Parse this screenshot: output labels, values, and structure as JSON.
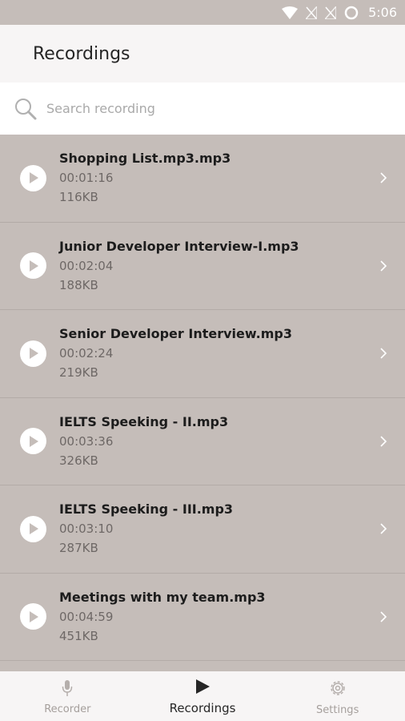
{
  "status_bar": {
    "time": "5:06",
    "icons": [
      "wifi-icon",
      "signal-off-icon",
      "signal-off-icon",
      "circle-icon"
    ]
  },
  "header": {
    "title": "Recordings"
  },
  "search": {
    "placeholder": "Search recording",
    "value": ""
  },
  "recordings": [
    {
      "name": "Shopping List.mp3.mp3",
      "duration": "00:01:16",
      "size": "116KB"
    },
    {
      "name": "Junior Developer Interview-I.mp3",
      "duration": "00:02:04",
      "size": "188KB"
    },
    {
      "name": "Senior Developer Interview.mp3",
      "duration": "00:02:24",
      "size": "219KB"
    },
    {
      "name": "IELTS Speeking - II.mp3",
      "duration": "00:03:36",
      "size": "326KB"
    },
    {
      "name": "IELTS Speeking - III.mp3",
      "duration": "00:03:10",
      "size": "287KB"
    },
    {
      "name": "Meetings with my team.mp3",
      "duration": "00:04:59",
      "size": "451KB"
    }
  ],
  "bottom_nav": {
    "tabs": [
      {
        "label": "Recorder",
        "icon": "microphone-icon",
        "active": false
      },
      {
        "label": "Recordings",
        "icon": "play-icon",
        "active": true
      },
      {
        "label": "Settings",
        "icon": "gear-icon",
        "active": false
      }
    ]
  },
  "colors": {
    "list_background": "#c5bdb9",
    "header_background": "#f7f5f5",
    "active_tab": "#262626",
    "inactive_tab": "#a59f9c"
  }
}
